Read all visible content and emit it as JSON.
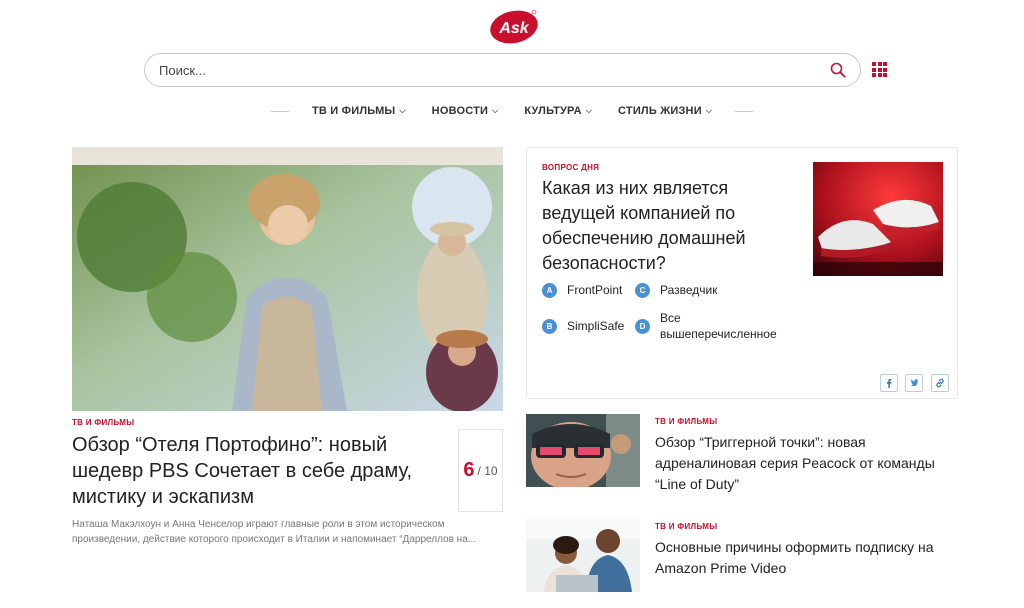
{
  "header": {
    "logo_text": "Ask",
    "search": {
      "placeholder": "Поиск..."
    }
  },
  "nav": {
    "items": [
      {
        "label": "ТВ И ФИЛЬМЫ"
      },
      {
        "label": "НОВОСТИ"
      },
      {
        "label": "КУЛЬТУРА"
      },
      {
        "label": "СТИЛЬ ЖИЗНИ"
      }
    ]
  },
  "feature": {
    "category": "ТВ И ФИЛЬМЫ",
    "title": "Обзор “Отеля Портофино”: новый шедевр PBS Сочетает в себе драму, мистику и эскапизм",
    "description": "Наташа Макэлхоун и Анна Ченселор играют главные роли в этом историческом произведении, действие которого происходит в Италии и напоминает “Дарреллов на...",
    "rating": {
      "score": "6",
      "out_of": "/ 10"
    }
  },
  "quiz": {
    "category": "ВОПРОС ДНЯ",
    "question": "Какая из них является ведущей компанией по обеспечению домашней безопасности?",
    "options": [
      {
        "letter": "A",
        "text": "FrontPoint"
      },
      {
        "letter": "C",
        "text": "Разведчик"
      },
      {
        "letter": "B",
        "text": "SimpliSafe"
      },
      {
        "letter": "D",
        "text": "Все вышеперечисленное"
      }
    ],
    "share": [
      "facebook-icon",
      "twitter-icon",
      "link-icon"
    ]
  },
  "side_articles": [
    {
      "category": "ТВ И ФИЛЬМЫ",
      "title": "Обзор “Триггерной точки”: новая адреналиновая серия Peacock от команды “Line of Duty”"
    },
    {
      "category": "ТВ И ФИЛЬМЫ",
      "title": "Основные причины оформить подписку на Amazon Prime Video"
    }
  ],
  "colors": {
    "brand": "#c8102e",
    "badge": "#4a90d9",
    "share_border": "#b9cfe4"
  }
}
